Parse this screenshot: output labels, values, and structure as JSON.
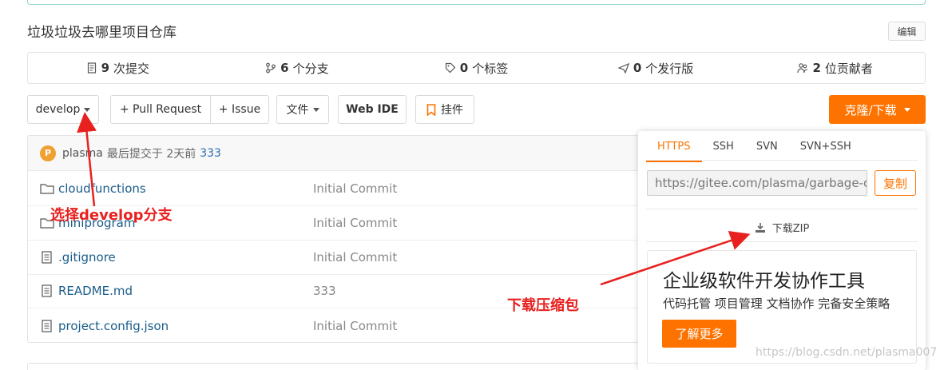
{
  "repo": {
    "description": "垃圾垃圾去哪里项目仓库",
    "edit_label": "编辑"
  },
  "stats": [
    {
      "icon": "commit-icon",
      "count": "9",
      "label": "次提交"
    },
    {
      "icon": "branch-icon",
      "count": "6",
      "label": "个分支"
    },
    {
      "icon": "tag-icon",
      "count": "0",
      "label": "个标签"
    },
    {
      "icon": "release-icon",
      "count": "0",
      "label": "个发行版"
    },
    {
      "icon": "contributors-icon",
      "count": "2",
      "label": "位贡献者"
    }
  ],
  "toolbar": {
    "branch": "develop",
    "pull_request": "+ Pull Request",
    "issue": "+ Issue",
    "files": "文件",
    "web_ide": "Web IDE",
    "pendant": "挂件",
    "clone": "克隆/下载"
  },
  "last_commit": {
    "avatar_letter": "P",
    "user": "plasma",
    "text": "最后提交于 2天前",
    "hash": "333"
  },
  "files": [
    {
      "type": "folder",
      "name": "cloudfunctions",
      "message": "Initial Commit"
    },
    {
      "type": "folder",
      "name": "miniprogram",
      "message": "Initial Commit"
    },
    {
      "type": "file",
      "name": ".gitignore",
      "message": "Initial Commit"
    },
    {
      "type": "file",
      "name": "README.md",
      "message": "333"
    },
    {
      "type": "file",
      "name": "project.config.json",
      "message": "Initial Commit"
    }
  ],
  "clone_panel": {
    "tabs": [
      "HTTPS",
      "SSH",
      "SVN",
      "SVN+SSH"
    ],
    "active_tab": "HTTPS",
    "url": "https://gitee.com/plasma/garbage-classification.git",
    "copy_label": "复制",
    "zip_label": "下载ZIP",
    "promo_title": "企业级软件开发协作工具",
    "promo_sub": "代码托管 项目管理 文档协作 完备安全策略",
    "promo_button": "了解更多"
  },
  "annotations": {
    "branch_note": "选择develop分支",
    "zip_note": "下载压缩包"
  },
  "watermark": "https://blog.csdn.net/plasma007",
  "colors": {
    "accent": "#fe7300",
    "annotation": "#e8201e",
    "link": "#1a5c8a"
  }
}
